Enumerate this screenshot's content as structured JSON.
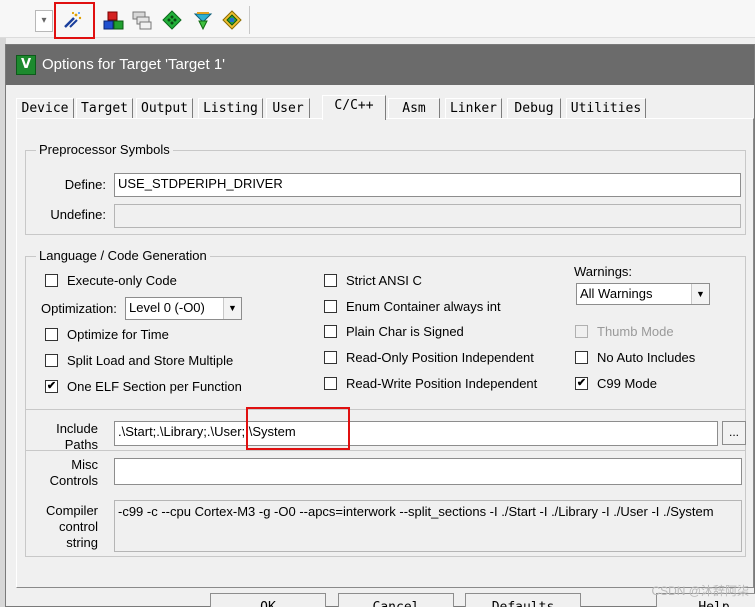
{
  "toolbar": {
    "buttons": [
      "options-for-target-icon",
      "manage-project-items-icon",
      "select-packs-icon",
      "manage-run-time-environment-icon",
      "pack-installer-icon",
      "component-icon"
    ]
  },
  "dialog": {
    "title": "Options for Target 'Target 1'",
    "tabs": [
      "Device",
      "Target",
      "Output",
      "Listing",
      "User",
      "C/C++",
      "Asm",
      "Linker",
      "Debug",
      "Utilities"
    ],
    "active_tab": "C/C++"
  },
  "preprocessor": {
    "title": "Preprocessor Symbols",
    "define_label": "Define:",
    "define_value": "USE_STDPERIPH_DRIVER",
    "undefine_label": "Undefine:",
    "undefine_value": ""
  },
  "language": {
    "title": "Language / Code Generation",
    "execute_only": {
      "label": "Execute-only Code",
      "checked": false
    },
    "optimization_label": "Optimization:",
    "optimization_value": "Level 0 (-O0)",
    "optimize_time": {
      "label": "Optimize for Time",
      "checked": false
    },
    "split_load": {
      "label": "Split Load and Store Multiple",
      "checked": false
    },
    "one_elf": {
      "label": "One ELF Section per Function",
      "checked": true
    },
    "strict_ansi": {
      "label": "Strict ANSI C",
      "checked": false
    },
    "enum_container": {
      "label": "Enum Container always int",
      "checked": false
    },
    "plain_char": {
      "label": "Plain Char is Signed",
      "checked": false
    },
    "ro_position": {
      "label": "Read-Only Position Independent",
      "checked": false
    },
    "rw_position": {
      "label": "Read-Write Position Independent",
      "checked": false
    },
    "warnings_label": "Warnings:",
    "warnings_value": "All Warnings",
    "thumb_mode": {
      "label": "Thumb Mode",
      "checked": false,
      "disabled": true
    },
    "no_auto_includes": {
      "label": "No Auto Includes",
      "checked": false
    },
    "c99_mode": {
      "label": "C99 Mode",
      "checked": true
    }
  },
  "paths": {
    "include_label_1": "Include",
    "include_label_2": "Paths",
    "include_value": ".\\Start;.\\Library;.\\User;.\\System",
    "browse_label": "...",
    "misc_label_1": "Misc",
    "misc_label_2": "Controls",
    "misc_value": "",
    "compiler_label_1": "Compiler",
    "compiler_label_2": "control",
    "compiler_label_3": "string",
    "compiler_value": "-c99 -c --cpu Cortex-M3 -g -O0 --apcs=interwork --split_sections -I ./Start -I ./Library -I ./User -I ./System"
  },
  "buttons": {
    "ok": "OK",
    "cancel": "Cancel",
    "defaults": "Defaults",
    "help": "Help"
  },
  "watermark": "CSDN @沐辞阿柒",
  "check_mark": "✔"
}
